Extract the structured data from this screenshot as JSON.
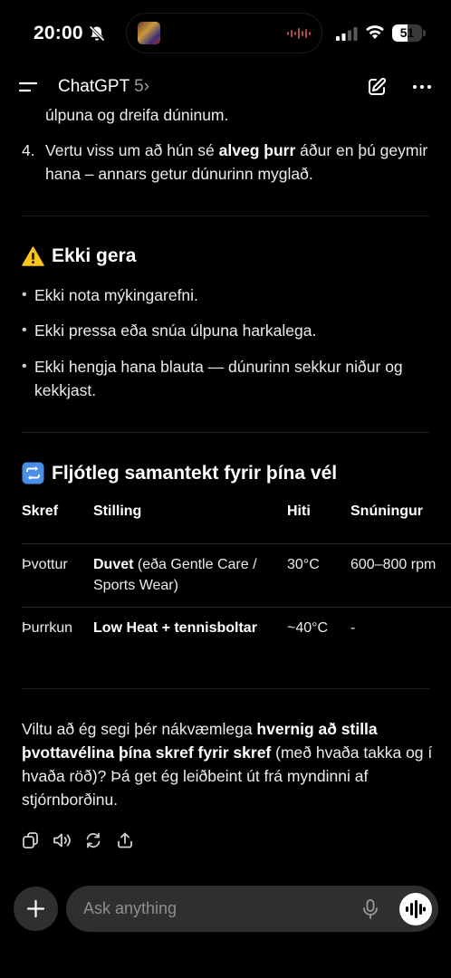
{
  "status_bar": {
    "time": "20:00",
    "battery": "51",
    "battery_level": 0.51
  },
  "header": {
    "title": "ChatGPT",
    "model_version": "5",
    "chevron": "›"
  },
  "content": {
    "cut_line": "úlpuna og dreifa dúninum.",
    "step4": {
      "num": "4.",
      "pre": "Vertu viss um að hún sé ",
      "bold": "alveg þurr",
      "post": " áður en þú geymir hana – annars getur dúnurinn myglað."
    },
    "dont_heading": "Ekki gera",
    "dont_items": [
      "Ekki nota mýkingarefni.",
      "Ekki pressa eða snúa úlpuna harkalega.",
      "Ekki hengja hana blauta — dúnurinn sekkur niður og kekkjast."
    ],
    "summary_heading": "Fljótleg samantekt fyrir þína vél",
    "table": {
      "headers": [
        "Skref",
        "Stilling",
        "Hiti",
        "Snúningur"
      ],
      "rows": [
        {
          "step": "Þvottur",
          "setting_bold": "Duvet",
          "setting_rest": " (eða Gentle Care / Sports Wear)",
          "temp": "30°C",
          "spin": "600–800 rpm"
        },
        {
          "step": "Þurrkun",
          "setting_bold": "Low Heat + tennisboltar",
          "setting_rest": "",
          "temp": "~40°C",
          "spin": "-"
        }
      ]
    },
    "final": {
      "pre": "Viltu að ég segi þér nákvæmlega ",
      "bold1": "hvernig að stilla þvottavélina þína skref fyrir skref",
      "post": " (með hvaða takka og í hvaða röð)? Þá get ég leiðbeint út frá myndinni af stjórnborðinu."
    }
  },
  "icons": [
    "bell-off-icon",
    "signal-icon",
    "wifi-icon",
    "battery-icon",
    "menu-icon",
    "chevron-right-icon",
    "new-chat-icon",
    "more-icon",
    "warning-icon",
    "repeat-icon",
    "copy-icon",
    "speaker-icon",
    "regenerate-icon",
    "share-icon",
    "plus-icon",
    "mic-icon",
    "voice-mode-icon"
  ],
  "composer": {
    "placeholder": "Ask anything"
  }
}
